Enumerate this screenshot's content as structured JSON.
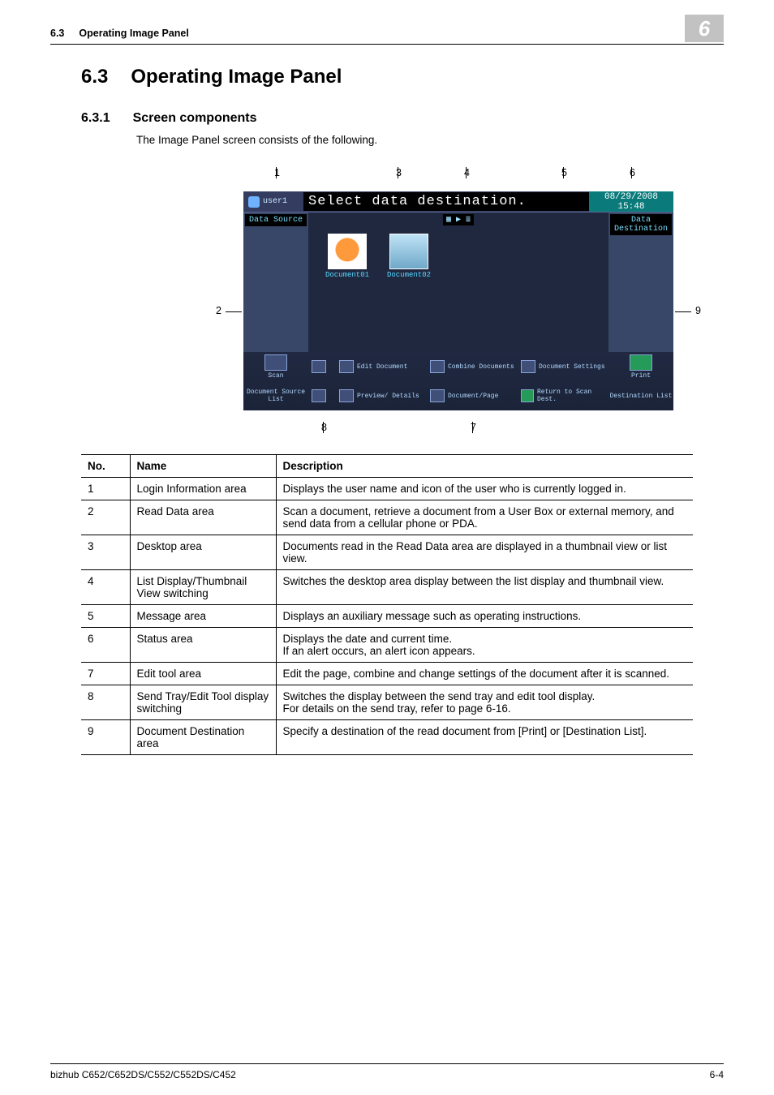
{
  "header": {
    "section_ref": "6.3",
    "section_name": "Operating Image Panel",
    "chapter_badge": "6"
  },
  "section": {
    "num": "6.3",
    "title": "Operating Image Panel"
  },
  "subsection": {
    "num": "6.3.1",
    "title": "Screen components",
    "intro": "The Image Panel screen consists of the following."
  },
  "screenshot": {
    "callouts_top": {
      "c1": "1",
      "c3": "3",
      "c4": "4",
      "c5": "5",
      "c6": "6"
    },
    "callouts_side": {
      "c2": "2",
      "c9": "9"
    },
    "callouts_bottom": {
      "c8": "8",
      "c7": "7"
    },
    "user_label": "user1",
    "instruction": "Select data destination.",
    "datetime": "08/29/2008 15:48",
    "left_header": "Data Source",
    "right_header": "Data Destination",
    "switch_a": "▦",
    "switch_b": "▶ ≣",
    "thumb1": "Document01",
    "thumb2": "Document02",
    "left_btn1": "Scan",
    "left_btn2": "Document Source List",
    "tool_edit": "Edit Document",
    "tool_preview": "Preview/ Details",
    "tool_combine": "Combine Documents",
    "tool_docpage": "Document/Page",
    "tool_settings": "Document Settings",
    "tool_return": "Return to Scan Dest.",
    "right_btn1": "Print",
    "right_btn2": "Destination List"
  },
  "table": {
    "head": {
      "no": "No.",
      "name": "Name",
      "desc": "Description"
    },
    "rows": [
      {
        "no": "1",
        "name": "Login Information area",
        "desc": "Displays the user name and icon of the user who is currently logged in."
      },
      {
        "no": "2",
        "name": "Read Data area",
        "desc": "Scan a document, retrieve a document from a User Box or external memory, and send data from a cellular phone or PDA."
      },
      {
        "no": "3",
        "name": "Desktop area",
        "desc": "Documents read in the Read Data area are displayed in a thumbnail view or list view."
      },
      {
        "no": "4",
        "name": "List Display/Thumbnail View switching",
        "desc": "Switches the desktop area display between the list display and thumbnail view."
      },
      {
        "no": "5",
        "name": "Message area",
        "desc": "Displays an auxiliary message such as operating instructions."
      },
      {
        "no": "6",
        "name": "Status area",
        "desc": "Displays the date and current time.\nIf an alert occurs, an alert icon appears."
      },
      {
        "no": "7",
        "name": "Edit tool area",
        "desc": "Edit the page, combine and change settings of the document after it is scanned."
      },
      {
        "no": "8",
        "name": "Send Tray/Edit Tool display switching",
        "desc": "Switches the display between the send tray and edit tool display.\nFor details on the send tray, refer to page 6-16."
      },
      {
        "no": "9",
        "name": "Document Destination area",
        "desc": "Specify a destination of the read document from [Print] or [Destination List]."
      }
    ]
  },
  "footer": {
    "model": "bizhub C652/C652DS/C552/C552DS/C452",
    "page": "6-4"
  }
}
